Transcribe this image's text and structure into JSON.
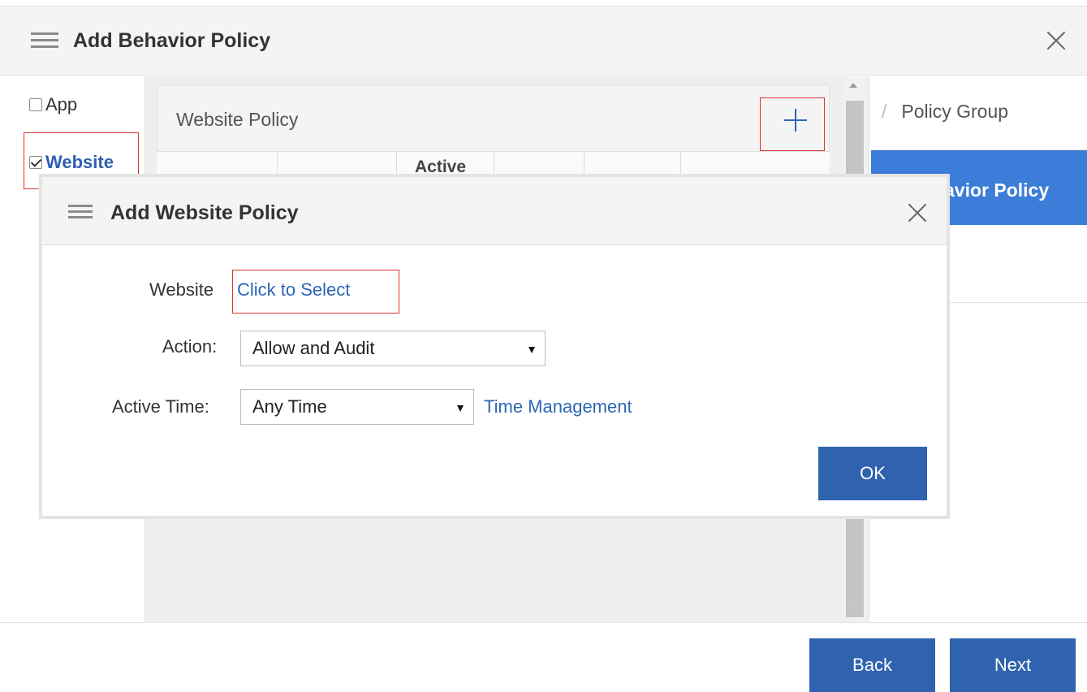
{
  "main_dialog": {
    "title": "Add Behavior Policy",
    "types": [
      {
        "label": "App",
        "checked": false
      },
      {
        "label": "Website",
        "checked": true
      }
    ],
    "website_policy": {
      "title": "Website Policy",
      "column_header_partial": "Active"
    },
    "steps": [
      {
        "label": "Policy Group",
        "state": "done"
      },
      {
        "label": "avior Policy",
        "state": "current"
      }
    ],
    "footer": {
      "back_label": "Back",
      "next_label": "Next"
    }
  },
  "sub_dialog": {
    "title": "Add Website Policy",
    "website": {
      "label": "Website",
      "link": "Click to Select"
    },
    "action": {
      "label": "Action:",
      "value": "Allow and Audit"
    },
    "active_time": {
      "label": "Active Time:",
      "value": "Any Time",
      "link": "Time Management"
    },
    "ok_label": "OK"
  },
  "colors": {
    "primary_button": "#2f63b0",
    "active_step": "#3b7dd8",
    "link": "#2e66b5",
    "highlight_box": "#e0322f"
  }
}
